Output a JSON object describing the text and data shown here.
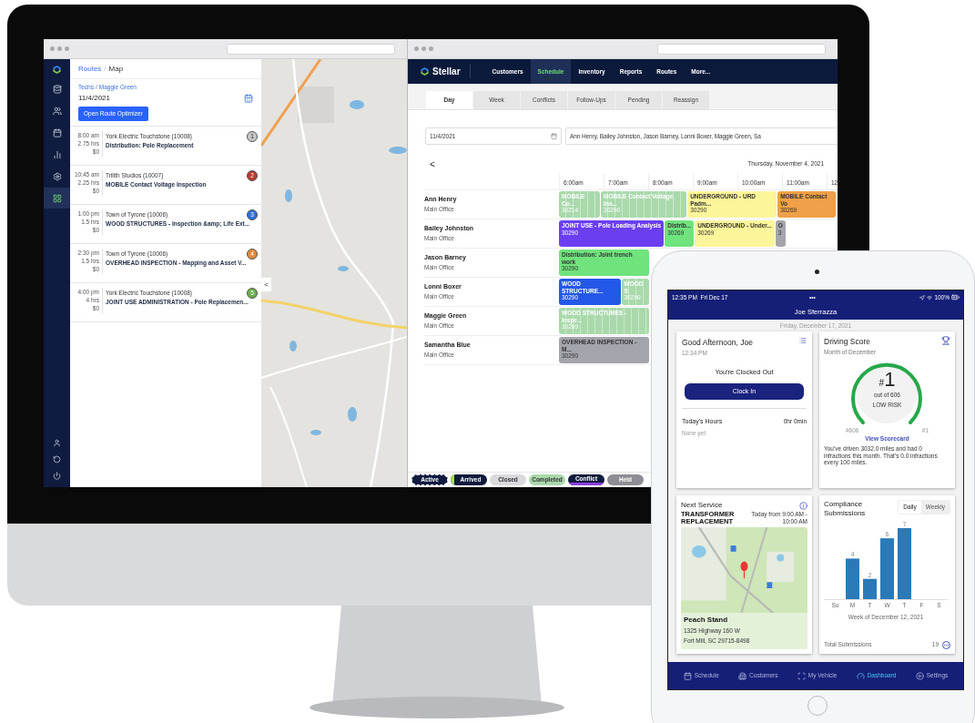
{
  "routes_window": {
    "sidebar": {
      "items": [
        {
          "selected": false
        },
        {
          "selected": false
        },
        {
          "selected": false
        },
        {
          "selected": false
        },
        {
          "selected": false
        },
        {
          "selected": true
        }
      ]
    },
    "breadcrumb": {
      "parent": "Routes",
      "separator": "/",
      "current": "Map"
    },
    "tech_path": {
      "parent": "Techs",
      "separator": "/",
      "current": "Maggie Green"
    },
    "date": "11/4/2021",
    "optimizer_button": "Open Route Optimizer",
    "stops": [
      {
        "time": "8:00 am",
        "duration": "2.75 hrs",
        "cost": "$0",
        "customer": "York Electric Touchstone (10008)",
        "job": "Distribution: Pole Replacement",
        "number": "1",
        "color": "#c8c8c8"
      },
      {
        "time": "10:45 am",
        "duration": "2.25 hrs",
        "cost": "$0",
        "customer": "Trilith Studios (10007)",
        "job": "MOBILE Contact Voltage Inspection",
        "number": "2",
        "color": "#b83a2e"
      },
      {
        "time": "1:00 pm",
        "duration": "1.5 hrs",
        "cost": "$0",
        "customer": "Town of Tyrone (10006)",
        "job": "WOOD STRUCTURES - Inspection &amp; Life Ext...",
        "number": "3",
        "color": "#2f6fd6"
      },
      {
        "time": "2:30 pm",
        "duration": "1.5 hrs",
        "cost": "$0",
        "customer": "Town of Tyrone (10006)",
        "job": "OVERHEAD INSPECTION - Mapping and Asset V...",
        "number": "4",
        "color": "#e08a3c"
      },
      {
        "time": "4:00 pm",
        "duration": "4 hrs",
        "cost": "$0",
        "customer": "York Electric Touchstone (10008)",
        "job": "JOINT USE ADMINISTRATION - Pole Replacemen...",
        "number": "5",
        "color": "#6ab04c"
      }
    ],
    "collapse_button": "<"
  },
  "schedule_window": {
    "brand": "Stellar",
    "nav": [
      {
        "label": "Customers",
        "selected": false
      },
      {
        "label": "Schedule",
        "selected": true
      },
      {
        "label": "Inventory",
        "selected": false
      },
      {
        "label": "Reports",
        "selected": false
      },
      {
        "label": "Routes",
        "selected": false
      },
      {
        "label": "More...",
        "selected": false
      }
    ],
    "tabs": [
      {
        "label": "Day",
        "selected": true
      },
      {
        "label": "Week",
        "selected": false
      },
      {
        "label": "Conflicts",
        "selected": false
      },
      {
        "label": "Follow-Ups",
        "selected": false
      },
      {
        "label": "Pending",
        "selected": false
      },
      {
        "label": "Reassign",
        "selected": false
      }
    ],
    "date_field": {
      "value": "11/4/2021"
    },
    "techs_field": {
      "value": "Ann Henry, Bailey Johnston, Jason Barney, Lonni Boxer, Maggie Green, Sa"
    },
    "back_button": "<",
    "date_heading": "Thursday, November 4, 2021",
    "hours": [
      "6:00am",
      "7:00am",
      "8:00am",
      "9:00am",
      "10:00am",
      "11:00am",
      "12"
    ],
    "rows": [
      {
        "name": "Ann Henry",
        "office": "Main Office",
        "events": [
          {
            "title": "MOBILE Co...",
            "code": "30214",
            "color": "#a9d9ab",
            "completed": true
          },
          {
            "title": "MOBILE Contact Voltage Ins...",
            "code": "30290",
            "color": "#a9d9ab",
            "completed": true
          },
          {
            "title": "UNDERGROUND - URD Padm...",
            "code": "30290",
            "color": "#fdf59a",
            "completed": false
          },
          {
            "title": "MOBILE Contact Vo",
            "code": "30269",
            "color": "#efa048",
            "completed": false
          }
        ]
      },
      {
        "name": "Bailey Johnston",
        "office": "Main Office",
        "events": [
          {
            "title": "JOINT USE - Pole Loading Analysis",
            "code": "30290",
            "color": "#6b3ff0",
            "completed": false
          },
          {
            "title": "Distrib...",
            "code": "30269",
            "color": "#6fe37c",
            "completed": false
          },
          {
            "title": "UNDERGROUND - Under...",
            "code": "30269",
            "color": "#fdf59a",
            "completed": false
          },
          {
            "title": "O",
            "code": "3",
            "color": "#a4a4ac",
            "completed": false
          }
        ]
      },
      {
        "name": "Jason Barney",
        "office": "Main Office",
        "events": [
          {
            "title": "Distribution: Joint trench work",
            "code": "30290",
            "color": "#6fe37c",
            "completed": false
          }
        ]
      },
      {
        "name": "Lonni Boxer",
        "office": "Main Office",
        "events": [
          {
            "title": "WOOD STRUCTURE...",
            "code": "30290",
            "color": "#2458e8",
            "completed": false
          },
          {
            "title": "WOOD S",
            "code": "30290",
            "color": "#a9d9ab",
            "completed": true
          }
        ]
      },
      {
        "name": "Maggie Green",
        "office": "Main Office",
        "events": [
          {
            "title": "WOOD STRUCTURES - Inspe...",
            "code": "30269",
            "color": "#a9d9ab",
            "completed": true
          }
        ]
      },
      {
        "name": "Samantha Blue",
        "office": "Main Office",
        "events": [
          {
            "title": "OVERHEAD INSPECTION - M...",
            "code": "30290",
            "color": "#a4a4ac",
            "completed": false
          }
        ]
      }
    ],
    "legend": [
      {
        "label": "Active",
        "color": "#0d1b3e",
        "kind": "dashed"
      },
      {
        "label": "Arrived",
        "color": "#0d1b3e",
        "kind": "left-accent",
        "stripe": {
          "color": "#a3e04c"
        }
      },
      {
        "label": "Closed",
        "color": "#d9d9de",
        "kind": "plain"
      },
      {
        "label": "Completed",
        "color": "#a9d9ab",
        "kind": "plain"
      },
      {
        "label": "Conflict",
        "color": "#0d1b3e",
        "kind": "bottom-accent",
        "stripe": {
          "color": "#8a3fe0"
        }
      },
      {
        "label": "Held",
        "color": "#8d8d94",
        "kind": "plain"
      }
    ]
  },
  "tablet": {
    "status_time": "12:35 PM  Fri Dec 17",
    "status_dots": "•••",
    "battery": "100%",
    "user": "Joe Sferrazza",
    "date": "Friday, December 17, 2021",
    "clock_card": {
      "greeting": "Good Afternoon, Joe",
      "time": "12:34 PM",
      "status": "You're Clocked Out",
      "button": "Clock In",
      "hours_label": "Today's Hours",
      "hours_value": "0hr 0min",
      "hours_note": "None yet"
    },
    "score_card": {
      "title": "Driving Score",
      "subtitle": "Month of December",
      "hash": "#",
      "rank": "1",
      "out_of": "out of 606",
      "risk": "LOW RISK",
      "scale_low": "#606",
      "scale_high": "#1",
      "link": "View Scorecard",
      "summary": "You've driven 3032.0 miles and had 0 infractions this month. That's 0.0 infractions every 100 miles."
    },
    "service_card": {
      "title": "Next Service",
      "job": "TRANSFORMER REPLACEMENT",
      "when": "Today from 9:00 AM - 10:00 AM",
      "place": "Peach Stand",
      "address_1": "1325 Highway 160 W",
      "address_2": "Fort Mill, SC 29715-8498"
    },
    "compliance_card": {
      "title": "Compliance Submissions",
      "toggle": [
        {
          "label": "Daily",
          "selected": true
        },
        {
          "label": "Weekly",
          "selected": false
        }
      ],
      "chart_data": {
        "type": "bar",
        "categories": [
          "Su",
          "M",
          "T",
          "W",
          "T",
          "F",
          "S"
        ],
        "values": [
          null,
          4,
          2,
          6,
          7,
          null,
          null
        ],
        "xlabel": "Week of December 12, 2021",
        "data_labels": true
      },
      "total_label": "Total Submissions",
      "total": "19"
    },
    "tab_bar": [
      {
        "label": "Schedule",
        "selected": false
      },
      {
        "label": "Customers",
        "selected": false
      },
      {
        "label": "My Vehicle",
        "selected": false
      },
      {
        "label": "Dashboard",
        "selected": true
      },
      {
        "label": "Settings",
        "selected": false
      }
    ]
  }
}
